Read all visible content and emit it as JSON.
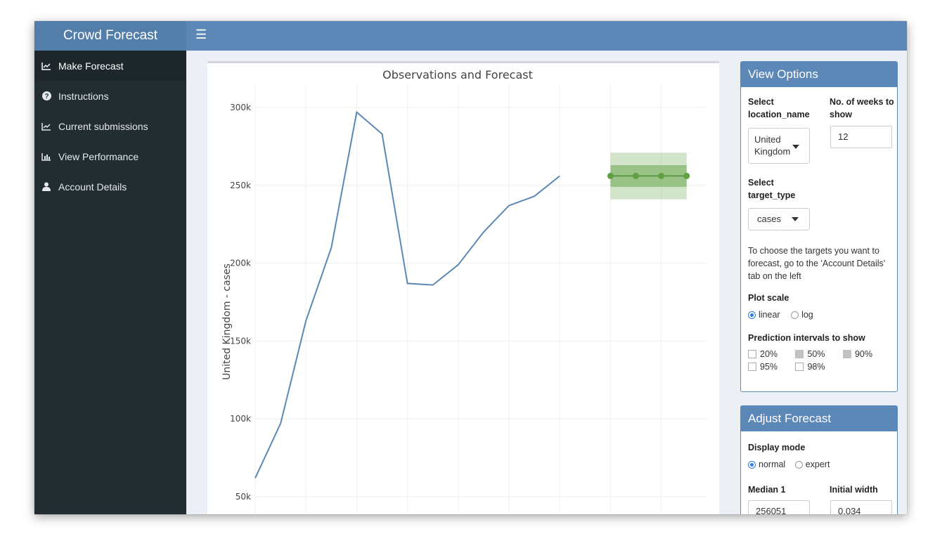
{
  "app": {
    "title": "Crowd Forecast",
    "menu_icon": "hamburger-icon"
  },
  "sidebar": {
    "items": [
      {
        "label": "Make Forecast",
        "icon": "line-chart-icon"
      },
      {
        "label": "Instructions",
        "icon": "question-circle-icon"
      },
      {
        "label": "Current submissions",
        "icon": "line-chart-icon"
      },
      {
        "label": "View Performance",
        "icon": "bar-chart-icon"
      },
      {
        "label": "Account Details",
        "icon": "user-icon"
      }
    ]
  },
  "chart_data": {
    "type": "line",
    "title": "Observations and Forecast",
    "ylabel": "United Kingdom - cases",
    "xlabel": "",
    "ylim": [
      45000,
      313000
    ],
    "yticks": [
      {
        "value": 50000,
        "label": "50k"
      },
      {
        "value": 100000,
        "label": "100k"
      },
      {
        "value": 150000,
        "label": "150k"
      },
      {
        "value": 200000,
        "label": "200k"
      },
      {
        "value": 250000,
        "label": "250k"
      },
      {
        "value": 300000,
        "label": "300k"
      }
    ],
    "grid": true,
    "observed": {
      "x": [
        0,
        1,
        2,
        3,
        4,
        5,
        6,
        7,
        8,
        9,
        10,
        11,
        12
      ],
      "y": [
        62000,
        97000,
        163000,
        210000,
        297000,
        283000,
        187000,
        186000,
        199000,
        220000,
        237000,
        243000,
        256000
      ],
      "color": "#5b88b6"
    },
    "forecast": {
      "x": [
        14,
        15,
        16,
        17
      ],
      "median": [
        256051,
        256051,
        256051,
        256051
      ],
      "interval_50": [
        249000,
        263000
      ],
      "interval_90": [
        241000,
        271000
      ],
      "color": "#6aa84f"
    }
  },
  "view_options": {
    "title": "View Options",
    "location_label": "Select location_name",
    "location_value": "United Kingdom",
    "weeks_label": "No. of weeks to show",
    "weeks_value": "12",
    "target_label": "Select target_type",
    "target_value": "cases",
    "note": "To choose the targets you want to forecast, go to the 'Account Details' tab on the left",
    "scale_label": "Plot scale",
    "scale_options": [
      "linear",
      "log"
    ],
    "scale_selected": "linear",
    "intervals_label": "Prediction intervals to show",
    "intervals": [
      {
        "label": "20%",
        "checked": false
      },
      {
        "label": "50%",
        "checked": true
      },
      {
        "label": "90%",
        "checked": true
      },
      {
        "label": "95%",
        "checked": false
      },
      {
        "label": "98%",
        "checked": false
      }
    ]
  },
  "adjust_forecast": {
    "title": "Adjust Forecast",
    "mode_label": "Display mode",
    "mode_options": [
      "normal",
      "expert"
    ],
    "mode_selected": "normal",
    "median_label": "Median 1",
    "median_value": "256051",
    "width_label": "Initial width",
    "width_value": "0.034"
  }
}
